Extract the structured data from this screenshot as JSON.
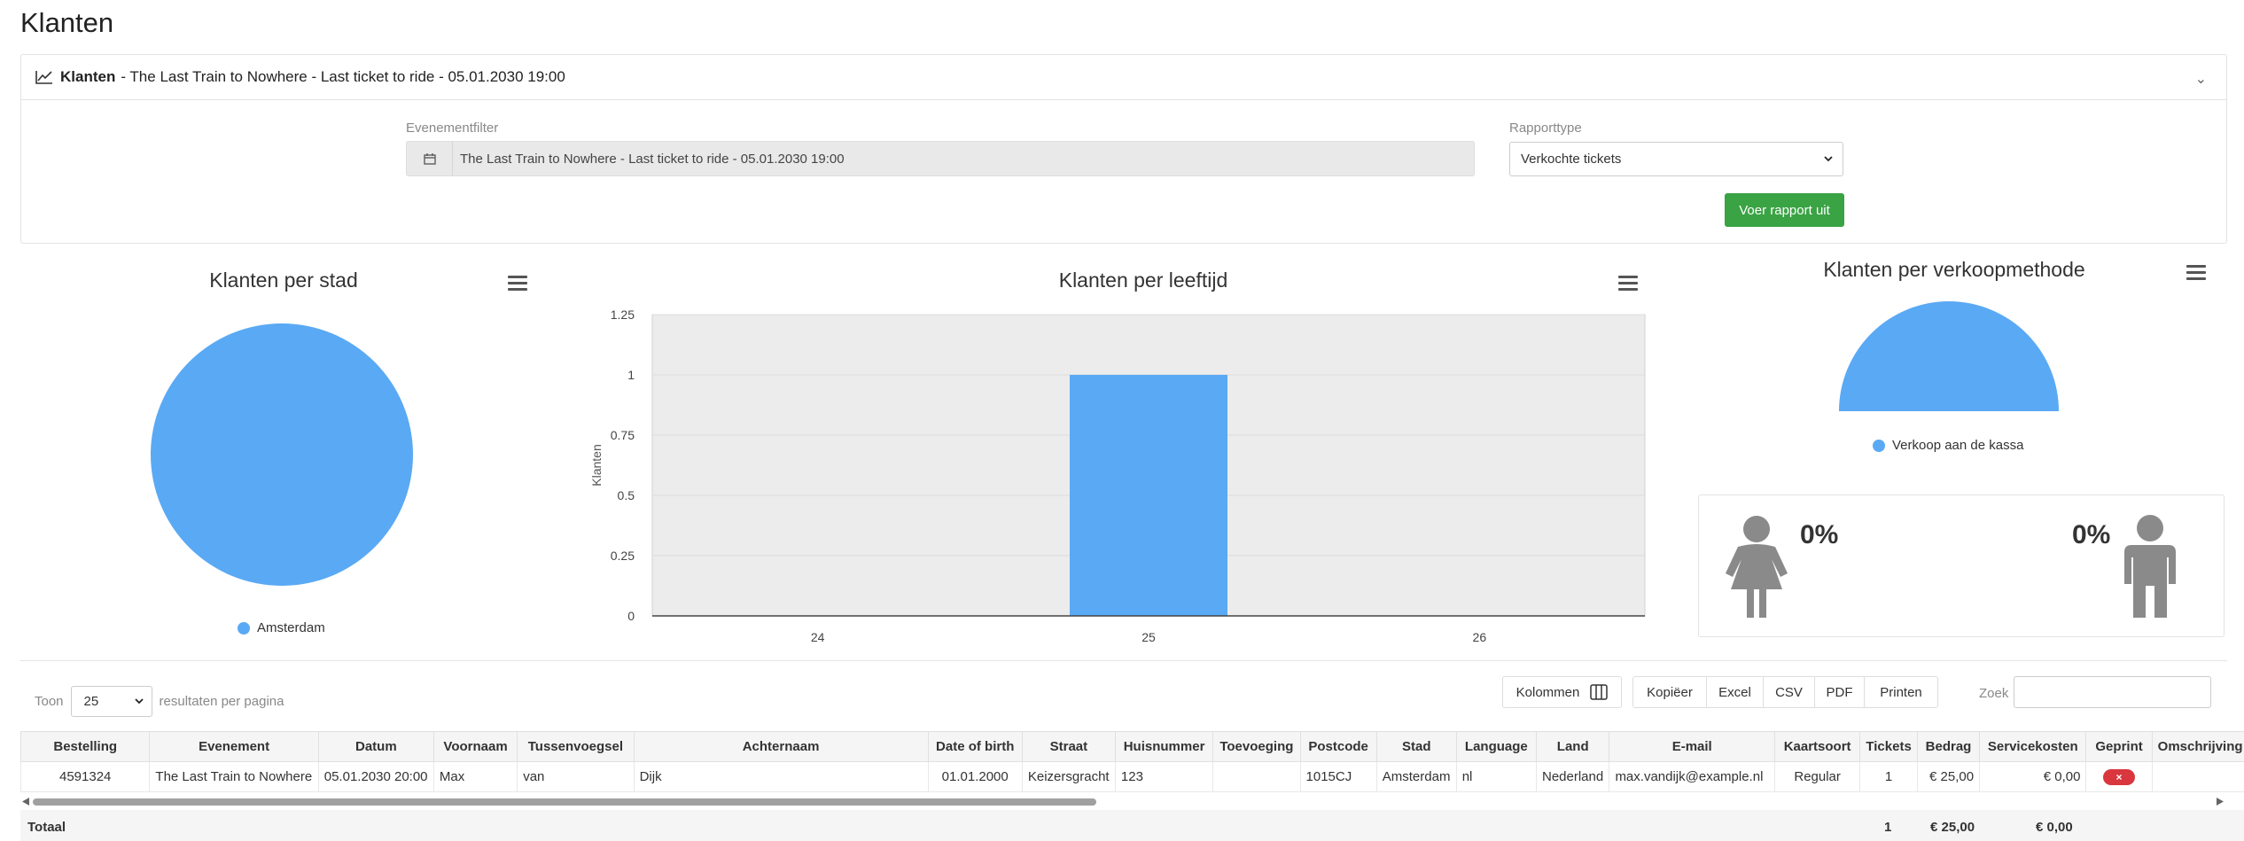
{
  "page": {
    "title": "Klanten"
  },
  "panel": {
    "header_bold": "Klanten",
    "header_rest": "- The Last Train to Nowhere - Last ticket to ride - 05.01.2030 19:00",
    "event_filter_label": "Evenementfilter",
    "event_filter_value": "The Last Train to Nowhere - Last ticket to ride - 05.01.2030 19:00",
    "report_type_label": "Rapporttype",
    "report_type_value": "Verkochte tickets",
    "run_button": "Voer rapport uit"
  },
  "charts": {
    "city_title": "Klanten per stad",
    "age_title": "Klanten per leeftijd",
    "method_title": "Klanten per verkoopmethode",
    "female_pct": "0%",
    "male_pct": "0%"
  },
  "chart_data": [
    {
      "type": "pie",
      "title": "Klanten per stad",
      "labels": [
        "Amsterdam"
      ],
      "values": [
        1
      ],
      "colors": [
        "#5aa9f4"
      ],
      "legend": "bottom"
    },
    {
      "type": "bar",
      "title": "Klanten per leeftijd",
      "categories": [
        "24",
        "25",
        "26"
      ],
      "values": [
        0,
        1,
        0
      ],
      "ylabel": "Klanten",
      "ylim": [
        0,
        1.25
      ],
      "yticks": [
        "0",
        "0.25",
        "0.5",
        "0.75",
        "1",
        "1.25"
      ],
      "grid": true,
      "color": "#5aa9f4"
    },
    {
      "type": "pie",
      "title": "Klanten per verkoopmethode",
      "labels": [
        "Verkoop aan de kassa"
      ],
      "values": [
        1
      ],
      "colors": [
        "#5aa9f4"
      ],
      "legend": "bottom"
    }
  ],
  "table_controls": {
    "show_label": "Toon",
    "page_size": "25",
    "per_page_label": "resultaten per pagina",
    "columns_button": "Kolommen",
    "copy_button": "Kopiëer",
    "excel_button": "Excel",
    "csv_button": "CSV",
    "pdf_button": "PDF",
    "print_button": "Printen",
    "search_label": "Zoek"
  },
  "table": {
    "headers": [
      "Bestelling",
      "Evenement",
      "Datum",
      "Voornaam",
      "Tussenvoegsel",
      "Achternaam",
      "Date of birth",
      "Straat",
      "Huisnummer",
      "Toevoeging",
      "Postcode",
      "Stad",
      "Language",
      "Land",
      "E-mail",
      "Kaartsoort",
      "Tickets",
      "Bedrag",
      "Servicekosten",
      "Geprint",
      "Omschrijving"
    ],
    "row": {
      "order": "4591324",
      "event": "The Last Train to Nowhere",
      "date": "05.01.2030 20:00",
      "first_name": "Max",
      "infix": "van",
      "last_name": "Dijk",
      "dob": "01.01.2000",
      "street": "Keizersgracht",
      "house_no": "123",
      "addition": "",
      "postcode": "1015CJ",
      "city": "Amsterdam",
      "language": "nl",
      "country": "Nederland",
      "email": "max.vandijk@example.nl",
      "ticket_type": "Regular",
      "tickets": "1",
      "amount": "€ 25,00",
      "service": "€ 0,00",
      "printed": "×"
    },
    "totals": {
      "label": "Totaal",
      "tickets": "1",
      "amount": "€ 25,00",
      "service": "€ 0,00"
    }
  }
}
